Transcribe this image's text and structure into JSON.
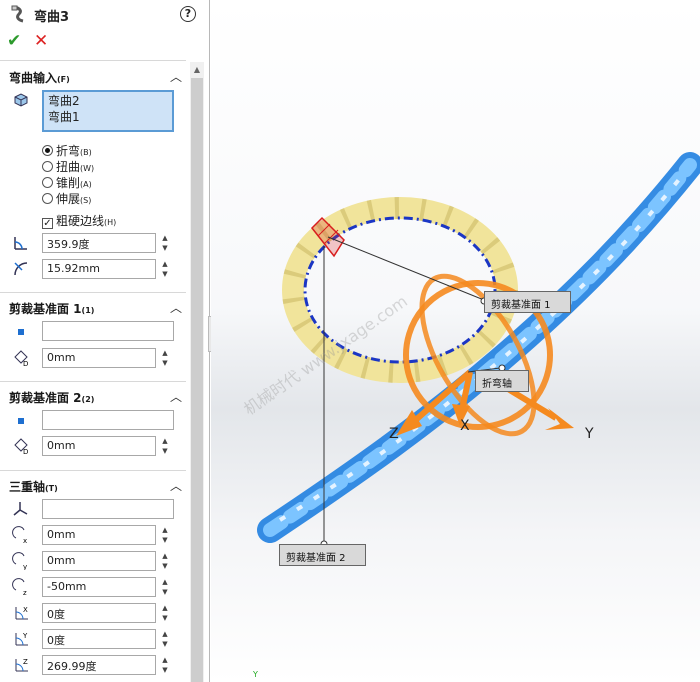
{
  "feature": {
    "title": "弯曲3"
  },
  "actions": {
    "help": "?",
    "ok": "✔",
    "cancel": "✕"
  },
  "input_section": {
    "label": "弯曲输入",
    "shortcut": "(F)",
    "list_items": [
      "弯曲2",
      "弯曲1"
    ],
    "options": [
      {
        "label": "折弯",
        "key": "(B)",
        "selected": true
      },
      {
        "label": "扭曲",
        "key": "(W)",
        "selected": false
      },
      {
        "label": "锥削",
        "key": "(A)",
        "selected": false
      },
      {
        "label": "伸展",
        "key": "(S)",
        "selected": false
      }
    ],
    "rough_edges": {
      "label": "粗硬边线",
      "key": "(H)",
      "checked": true
    },
    "angle": "359.9度",
    "radius": "15.92mm"
  },
  "trim_plane_1": {
    "label": "剪裁基准面 1",
    "shortcut": "(1)",
    "entity": "",
    "distance": "0mm"
  },
  "trim_plane_2": {
    "label": "剪裁基准面 2",
    "shortcut": "(2)",
    "entity": "",
    "distance": "0mm"
  },
  "triad": {
    "label": "三重轴",
    "shortcut": "(T)",
    "entity": "",
    "x": "0mm",
    "y": "0mm",
    "z": "-50mm",
    "rot_x": "0度",
    "rot_y": "0度",
    "rot_z": "269.99度"
  },
  "viewport": {
    "callout_plane1": "剪裁基准面 1",
    "callout_plane2": "剪裁基准面 2",
    "callout_bend_axis": "折弯轴",
    "axis_z": "Z",
    "axis_x": "X",
    "axis_y": "Y",
    "watermark": "机械时代 www.jxage.com",
    "mini_y": "Y"
  },
  "colors": {
    "spring": "#3d9ff0",
    "ring": "#f3e9a8",
    "triad": "#f58a1f",
    "selection": "#5b9bd5",
    "ok": "#2c9a2c",
    "cancel": "#dd2222"
  }
}
